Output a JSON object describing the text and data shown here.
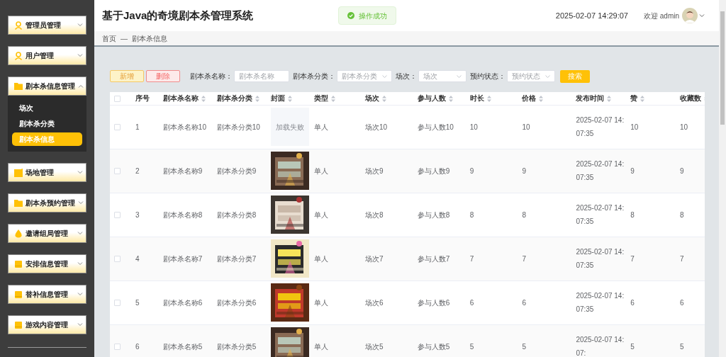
{
  "header": {
    "title": "基于Java的奇境剧本杀管理系统",
    "toast": "操作成功",
    "datetime": "2025-02-07 14:29:07",
    "welcome": "欢迎 admin"
  },
  "sidebar": {
    "items": [
      {
        "label": "管理员管理",
        "kind": "person",
        "expanded": false
      },
      {
        "label": "用户管理",
        "kind": "person",
        "expanded": false
      },
      {
        "label": "剧本杀信息管理",
        "kind": "folder",
        "expanded": true,
        "children": [
          {
            "label": "场次",
            "selected": false
          },
          {
            "label": "剧本杀分类",
            "selected": false
          },
          {
            "label": "剧本杀信息",
            "selected": true
          }
        ]
      },
      {
        "label": "场地管理",
        "kind": "note",
        "expanded": false
      },
      {
        "label": "剧本杀预约管理",
        "kind": "folder",
        "expanded": false
      },
      {
        "label": "邀请组局管理",
        "kind": "drop",
        "expanded": false
      },
      {
        "label": "安排信息管理",
        "kind": "card",
        "expanded": false
      },
      {
        "label": "替补信息管理",
        "kind": "card",
        "expanded": false
      },
      {
        "label": "游戏内容管理",
        "kind": "card",
        "expanded": false
      }
    ]
  },
  "breadcrumb": [
    "首页",
    "剧本杀信息"
  ],
  "breadcrumb_separator": "—",
  "toolbar": {
    "add": "新增",
    "delete": "删除",
    "filters": [
      {
        "label": "剧本杀名称：",
        "placeholder": "剧本杀名称",
        "kind": "input"
      },
      {
        "label": "剧本杀分类：",
        "placeholder": "剧本杀分类",
        "kind": "select"
      },
      {
        "label": "场次：",
        "placeholder": "场次",
        "kind": "select"
      },
      {
        "label": "预约状态：",
        "placeholder": "预约状态",
        "kind": "select"
      }
    ],
    "search": "搜索"
  },
  "table": {
    "select_all": {
      "checked": false
    },
    "columns": [
      {
        "label": "序号",
        "sortable": false
      },
      {
        "label": "剧本杀名称",
        "sortable": true
      },
      {
        "label": "剧本杀分类",
        "sortable": true
      },
      {
        "label": "封面",
        "sortable": true
      },
      {
        "label": "类型",
        "sortable": true
      },
      {
        "label": "场次",
        "sortable": true
      },
      {
        "label": "参与人数",
        "sortable": true
      },
      {
        "label": "时长",
        "sortable": true
      },
      {
        "label": "价格",
        "sortable": true
      },
      {
        "label": "发布时间",
        "sortable": true
      },
      {
        "label": "赞",
        "sortable": true
      },
      {
        "label": "收藏数",
        "sortable": true
      }
    ],
    "rows": [
      {
        "checked": false,
        "cells": [
          "1",
          "剧本杀名称10",
          "剧本杀分类10",
          null,
          "单人",
          "场次10",
          "参与人数10",
          "10",
          "10",
          "2025-02-07 14:07:35",
          "10",
          "10"
        ],
        "cover": {
          "kind": "failed",
          "text": "加载失败"
        }
      },
      {
        "checked": false,
        "cells": [
          "2",
          "剧本杀名称9",
          "剧本杀分类9",
          null,
          "单人",
          "场次9",
          "参与人数9",
          "9",
          "9",
          "2025-02-07 14:07:35",
          "9",
          "9"
        ]
      },
      {
        "checked": false,
        "cells": [
          "3",
          "剧本杀名称8",
          "剧本杀分类8",
          null,
          "单人",
          "场次8",
          "参与人数8",
          "8",
          "8",
          "2025-02-07 14:07:35",
          "8",
          "8"
        ]
      },
      {
        "checked": false,
        "cells": [
          "4",
          "剧本杀名称7",
          "剧本杀分类7",
          null,
          "单人",
          "场次7",
          "参与人数7",
          "7",
          "7",
          "2025-02-07 14:07:35",
          "7",
          "7"
        ]
      },
      {
        "checked": false,
        "cells": [
          "5",
          "剧本杀名称6",
          "剧本杀分类6",
          null,
          "单人",
          "场次6",
          "参与人数6",
          "6",
          "6",
          "2025-02-07 14:07:35",
          "6",
          "6"
        ]
      },
      {
        "checked": false,
        "cells": [
          "6",
          "剧本杀名称5",
          "剧本杀分类5",
          null,
          "单人",
          "场次5",
          "参与人数5",
          "5",
          "5",
          "2025-02-07 14:07:",
          "5",
          "5"
        ]
      }
    ]
  }
}
